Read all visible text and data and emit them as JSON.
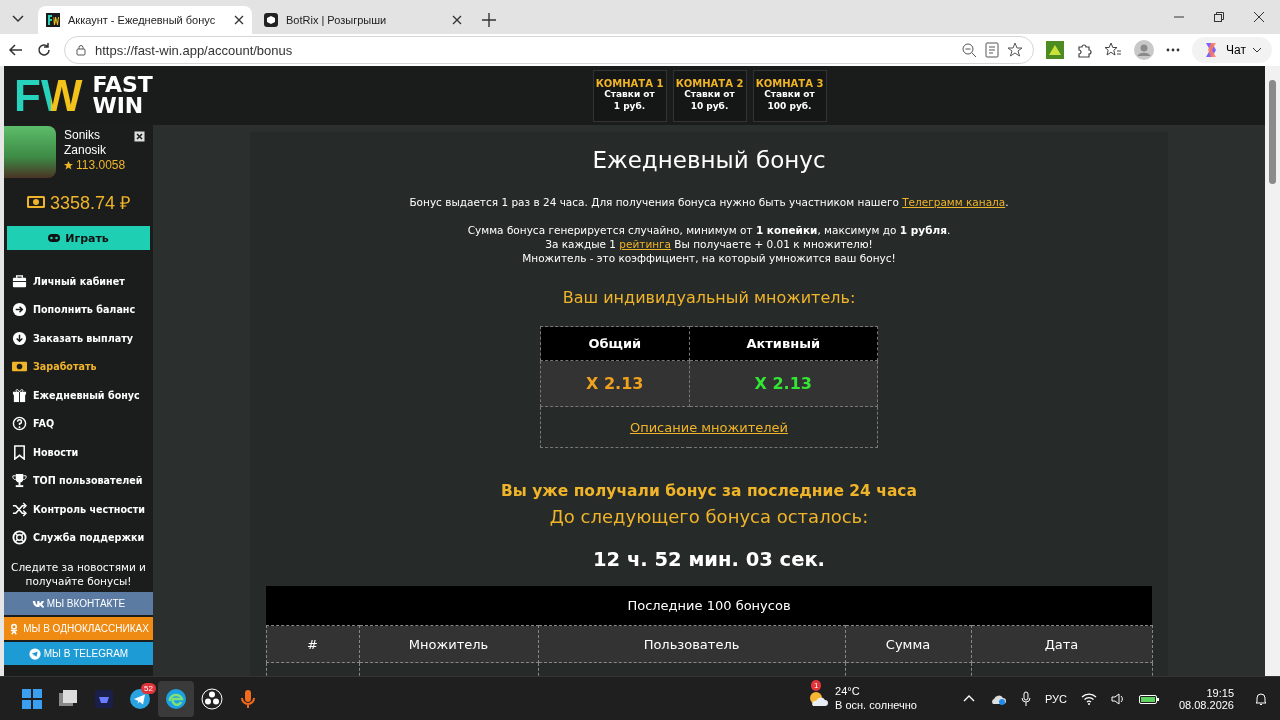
{
  "browser": {
    "tabs": [
      {
        "title": "Аккаунт - Ежедневный бонус",
        "kind": "fastwin",
        "selected": true
      },
      {
        "title": "BotRix | Розыгрыши",
        "kind": "botrix",
        "selected": false
      }
    ],
    "url": "https://fast-win.app/account/bonus",
    "chat_label": "Чат"
  },
  "header": {
    "logo": {
      "mark": "FW",
      "line1": "FAST",
      "line2": "WIN"
    },
    "rooms": [
      {
        "title": "КОМНАТА 1",
        "subtitle": "Ставки от 1 руб."
      },
      {
        "title": "КОМНАТА 2",
        "subtitle": "Ставки от 10 руб."
      },
      {
        "title": "КОМНАТА 3",
        "subtitle": "Ставки от 100 руб."
      }
    ]
  },
  "sidebar": {
    "user": {
      "name": "Soniks Zanosik",
      "rating": "113.0058"
    },
    "balance": "3358.74 ₽",
    "play_label": "Играть",
    "menu": [
      {
        "label": "Личный кабинет",
        "kind": "briefcase",
        "highlighted": false
      },
      {
        "label": "Пополнить баланс",
        "kind": "deposit",
        "highlighted": false
      },
      {
        "label": "Заказать выплату",
        "kind": "withdraw",
        "highlighted": false
      },
      {
        "label": "Заработать",
        "kind": "earn",
        "highlighted": true
      },
      {
        "label": "Ежедневный бонус",
        "kind": "gift",
        "highlighted": false
      },
      {
        "label": "FAQ",
        "kind": "faq",
        "highlighted": false
      },
      {
        "label": "Новости",
        "kind": "news",
        "highlighted": false
      },
      {
        "label": "ТОП пользователей",
        "kind": "top",
        "highlighted": false
      },
      {
        "label": "Контроль честности",
        "kind": "fairness",
        "highlighted": false
      },
      {
        "label": "Служба поддержки",
        "kind": "support",
        "highlighted": false
      }
    ],
    "follow_text": "Следите за новостями и получайте бонусы!",
    "socials": [
      {
        "label": "МЫ ВКОНТАКТЕ",
        "kind": "vk",
        "color": "#5b7ba3"
      },
      {
        "label": "МЫ В ОДНОКЛАССНИКАХ",
        "kind": "ok",
        "color": "#ef8a12"
      },
      {
        "label": "МЫ В TELEGRAM",
        "kind": "telegram",
        "color": "#1d9bd5"
      }
    ]
  },
  "main": {
    "title": "Ежедневный бонус",
    "info_1": {
      "text": "Бонус выдается 1 раз в 24 часа. Для получения бонуса нужно быть участником нашего ",
      "link": "Телеграмм канала",
      "after": "."
    },
    "info_2": "Сумма бонуса генерируется случайно, минимум от **1 копейки**, максимум до **1 рубля**.",
    "info_3": {
      "text": "За каждые 1 ",
      "link": "рейтинга",
      "after": " Вы получаете + 0.01 к множителю!"
    },
    "info_4": "Множитель - это коэффициент, на который умножится ваш бонус!",
    "multiplier_heading": "Ваш индивидуальный множитель:",
    "multipliers": {
      "columns": [
        {
          "label": "Общий",
          "value": "X 2.13",
          "color": "#f0a21e"
        },
        {
          "label": "Активный",
          "value": "X 2.13",
          "color": "#33e633"
        }
      ],
      "link": "Описание множителей"
    },
    "status": "Вы уже получали бонус за последние 24 часа",
    "countdown_label": "До следующего бонуса осталось:",
    "countdown": "12 ч. 52 мин. 03 сек.",
    "history": {
      "title": "Последние 100 бонусов",
      "columns": [
        "#",
        "Множитель",
        "Пользователь",
        "Сумма",
        "Дата"
      ]
    }
  },
  "taskbar": {
    "apps": [
      {
        "kind": "start",
        "active": false
      },
      {
        "kind": "files",
        "active": false
      },
      {
        "kind": "game",
        "active": false
      },
      {
        "kind": "telegram",
        "badge": "52",
        "active": false
      },
      {
        "kind": "edge",
        "active": true
      },
      {
        "kind": "obs",
        "active": false
      },
      {
        "kind": "mic-app",
        "active": false
      }
    ],
    "weather": {
      "badge": "1",
      "temp": "24°C",
      "text": "В осн. солнечно"
    },
    "language": "РУС",
    "time": "19:15",
    "date": "08.08.2026"
  }
}
